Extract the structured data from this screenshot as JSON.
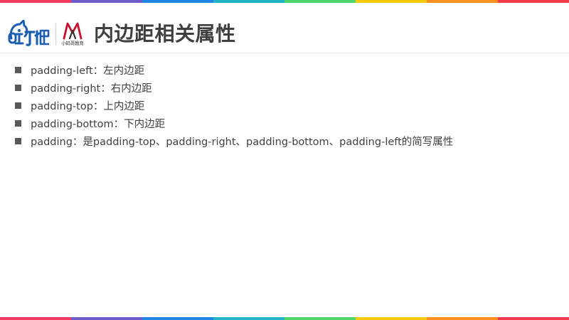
{
  "slide": {
    "title": "内边距相关属性",
    "logo_small_text": "小码哥教育",
    "bullets": [
      "padding-left：左内边距",
      "padding-right：右内边距",
      "padding-top：上内边距",
      "padding-bottom：下内边距",
      "padding：是padding-top、padding-right、padding-bottom、padding-left的简写属性"
    ]
  },
  "colors": {
    "stripe": [
      "#f43b5f",
      "#6d5cc9",
      "#1f86e6",
      "#23b3c6",
      "#4fd66b",
      "#f6c90b",
      "#fb8f1e",
      "#f3394b"
    ],
    "title": "#3f3f3f",
    "text": "#404040",
    "bullet": "#595959",
    "logo_blue": "#1c5fb2",
    "logo_red": "#c8102e"
  },
  "icons": {
    "logo_left": "mascot-wordmark-logo",
    "logo_right": "mj-mark-logo",
    "bullet": "square-bullet"
  }
}
